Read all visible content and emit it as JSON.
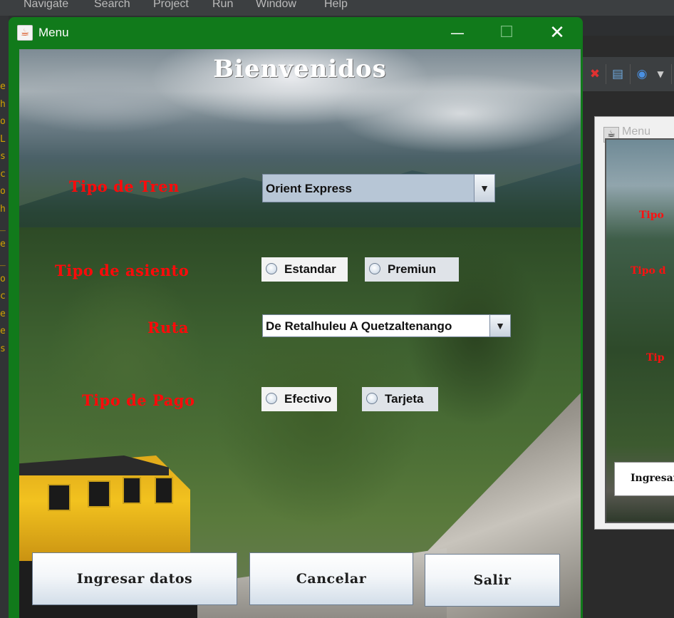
{
  "ide": {
    "menu": [
      "Navigate",
      "Search",
      "Project",
      "Run",
      "Window",
      "Help"
    ],
    "left_chars": [
      "e",
      "h",
      "o",
      "L",
      "s",
      "c",
      "o",
      "h",
      "_",
      "e",
      "_",
      "o",
      "c",
      "e",
      "e",
      "s"
    ]
  },
  "preview": {
    "title": "Menu",
    "labels": [
      "Tipo",
      "Tipo d",
      "Tip"
    ],
    "button": "Ingresar datos"
  },
  "window": {
    "title": "Menu",
    "controls": {
      "minimize": "—",
      "maximize": "☐",
      "close": "✕"
    }
  },
  "form": {
    "heading": "Bienvenidos",
    "train_type": {
      "label": "Tipo de Tren",
      "selected": "Orient Express"
    },
    "seat_type": {
      "label": "Tipo de asiento",
      "options": [
        "Estandar",
        "Premiun"
      ]
    },
    "route": {
      "label": "Ruta",
      "selected": "De Retalhuleu A Quetzaltenango"
    },
    "payment": {
      "label": "Tipo de Pago",
      "options": [
        "Efectivo",
        "Tarjeta"
      ]
    }
  },
  "buttons": {
    "enter": "Ingresar datos",
    "cancel": "Cancelar",
    "exit": "Salir"
  },
  "colors": {
    "label_red": "#ff0a0a",
    "titlebar_green": "#117a1b"
  }
}
